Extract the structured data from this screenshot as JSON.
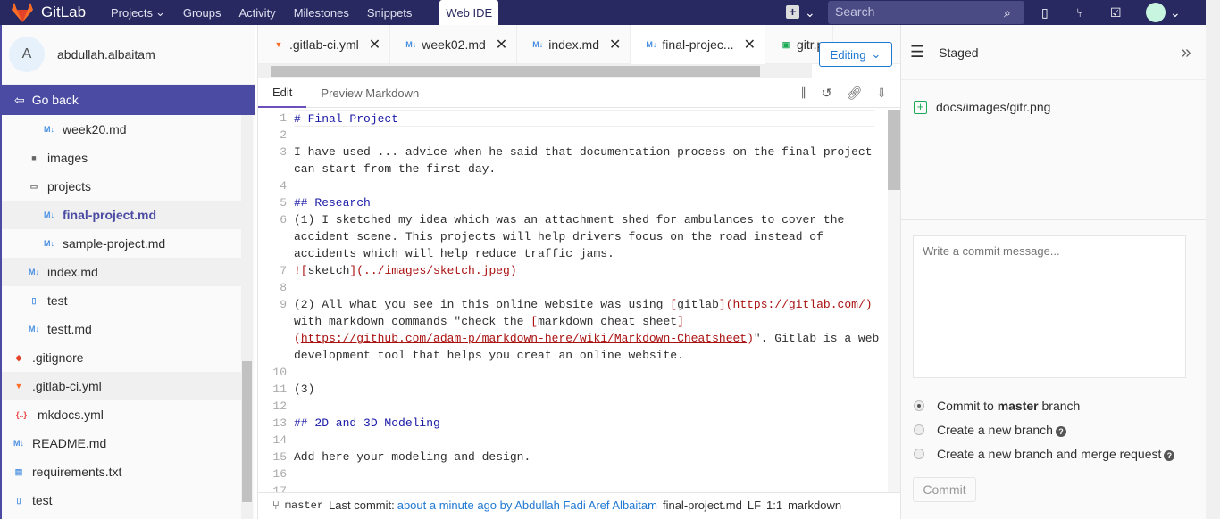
{
  "nav": {
    "brand": "GitLab",
    "items": [
      "Projects",
      "Groups",
      "Activity",
      "Milestones",
      "Snippets"
    ],
    "web_ide": "Web IDE",
    "search_placeholder": "Search"
  },
  "sidebar": {
    "avatar_letter": "A",
    "username": "abdullah.albaitam",
    "go_back": "Go back",
    "tree": [
      {
        "name": "week20.md",
        "icon": "markdown-icon",
        "indent": 3
      },
      {
        "name": "images",
        "icon": "folder-icon",
        "indent": 2
      },
      {
        "name": "projects",
        "icon": "folder-open-icon",
        "indent": 2
      },
      {
        "name": "final-project.md",
        "icon": "markdown-icon",
        "indent": 3,
        "state": "active"
      },
      {
        "name": "sample-project.md",
        "icon": "markdown-icon",
        "indent": 3
      },
      {
        "name": "index.md",
        "icon": "markdown-icon",
        "indent": 2,
        "state": "hover"
      },
      {
        "name": "test",
        "icon": "file-icon",
        "indent": 2
      },
      {
        "name": "testt.md",
        "icon": "markdown-icon",
        "indent": 2
      },
      {
        "name": ".gitignore",
        "icon": "git-icon",
        "indent": 1
      },
      {
        "name": ".gitlab-ci.yml",
        "icon": "gitlab-icon",
        "indent": 1,
        "state": "hover"
      },
      {
        "name": "mkdocs.yml",
        "icon": "yaml-icon",
        "indent": 1
      },
      {
        "name": "README.md",
        "icon": "markdown-icon",
        "indent": 1
      },
      {
        "name": "requirements.txt",
        "icon": "text-file-icon",
        "indent": 1
      },
      {
        "name": "test",
        "icon": "file-icon",
        "indent": 1
      }
    ]
  },
  "editor": {
    "tabs": [
      {
        "label": ".gitlab-ci.yml",
        "icon": "gitlab-icon"
      },
      {
        "label": "week02.md",
        "icon": "markdown-icon"
      },
      {
        "label": "index.md",
        "icon": "markdown-icon"
      },
      {
        "label": "final-projec...",
        "icon": "markdown-icon",
        "active": true
      },
      {
        "label": "gitr.p",
        "icon": "image-icon"
      }
    ],
    "mode": "Editing",
    "edit_tab": "Edit",
    "preview_tab": "Preview Markdown",
    "lines": [
      {
        "n": "1",
        "segs": [
          [
            "h",
            "# Final Project"
          ]
        ]
      },
      {
        "n": "2",
        "segs": []
      },
      {
        "n": "3",
        "segs": [
          [
            "",
            "I have used ... advice when he said that documentation process on the final project"
          ]
        ]
      },
      {
        "n": "",
        "segs": [
          [
            "",
            "can start from the first day."
          ]
        ]
      },
      {
        "n": "4",
        "segs": []
      },
      {
        "n": "5",
        "segs": [
          [
            "h",
            "## Research"
          ]
        ]
      },
      {
        "n": "6",
        "segs": [
          [
            "",
            "(1) I sketched my idea which was an attachment shed for ambulances to cover the"
          ]
        ]
      },
      {
        "n": "",
        "segs": [
          [
            "",
            "accident scene. This projects will help drivers focus on the road instead of"
          ]
        ]
      },
      {
        "n": "",
        "segs": [
          [
            "",
            "accidents which will help reduce traffic jams."
          ]
        ]
      },
      {
        "n": "7",
        "segs": [
          [
            "br",
            "!["
          ],
          [
            "",
            "sketch"
          ],
          [
            "br",
            "]"
          ],
          [
            "lk",
            "(../images/sketch.jpeg)"
          ]
        ]
      },
      {
        "n": "8",
        "segs": []
      },
      {
        "n": "9",
        "segs": [
          [
            "",
            "(2) All what you see in this online website was using "
          ],
          [
            "br",
            "["
          ],
          [
            "",
            "gitlab"
          ],
          [
            "br",
            "]("
          ],
          [
            "u",
            "https://gitlab.com/"
          ],
          [
            "br",
            ")"
          ]
        ]
      },
      {
        "n": "",
        "segs": [
          [
            "",
            "with markdown commands \"check the "
          ],
          [
            "br",
            "["
          ],
          [
            "",
            "markdown cheat sheet"
          ],
          [
            "br",
            "]"
          ]
        ]
      },
      {
        "n": "",
        "segs": [
          [
            "br",
            "("
          ],
          [
            "u",
            "https://github.com/adam-p/markdown-here/wiki/Markdown-Cheatsheet"
          ],
          [
            "br",
            ")"
          ],
          [
            "",
            "\". Gitlab is a web"
          ]
        ]
      },
      {
        "n": "",
        "segs": [
          [
            "",
            "development tool that helps you creat an online website."
          ]
        ]
      },
      {
        "n": "10",
        "segs": []
      },
      {
        "n": "11",
        "segs": [
          [
            "",
            "(3)"
          ]
        ]
      },
      {
        "n": "12",
        "segs": []
      },
      {
        "n": "13",
        "segs": [
          [
            "h",
            "## 2D and 3D Modeling"
          ]
        ]
      },
      {
        "n": "14",
        "segs": []
      },
      {
        "n": "15",
        "segs": [
          [
            "",
            "Add here your modeling and design."
          ]
        ]
      },
      {
        "n": "16",
        "segs": []
      },
      {
        "n": "17",
        "segs": []
      }
    ],
    "status": {
      "branch": "master",
      "last_commit_label": "Last commit:",
      "last_commit": "about a minute ago by Abdullah Fadi Aref Albaitam",
      "file": "final-project.md",
      "eol": "LF",
      "position": "1:1",
      "language": "markdown"
    }
  },
  "commit_panel": {
    "title": "Staged",
    "staged_files": [
      "docs/images/gitr.png"
    ],
    "message_placeholder": "Write a commit message...",
    "option1_pre": "Commit to ",
    "option1_branch": "master",
    "option1_post": " branch",
    "option2": "Create a new branch",
    "option3": "Create a new branch and merge request",
    "commit_button": "Commit"
  },
  "colors": {
    "navbar": "#292961",
    "accent": "#4b4ba3",
    "link": "#1f78d1",
    "added": "#1aaa55"
  }
}
